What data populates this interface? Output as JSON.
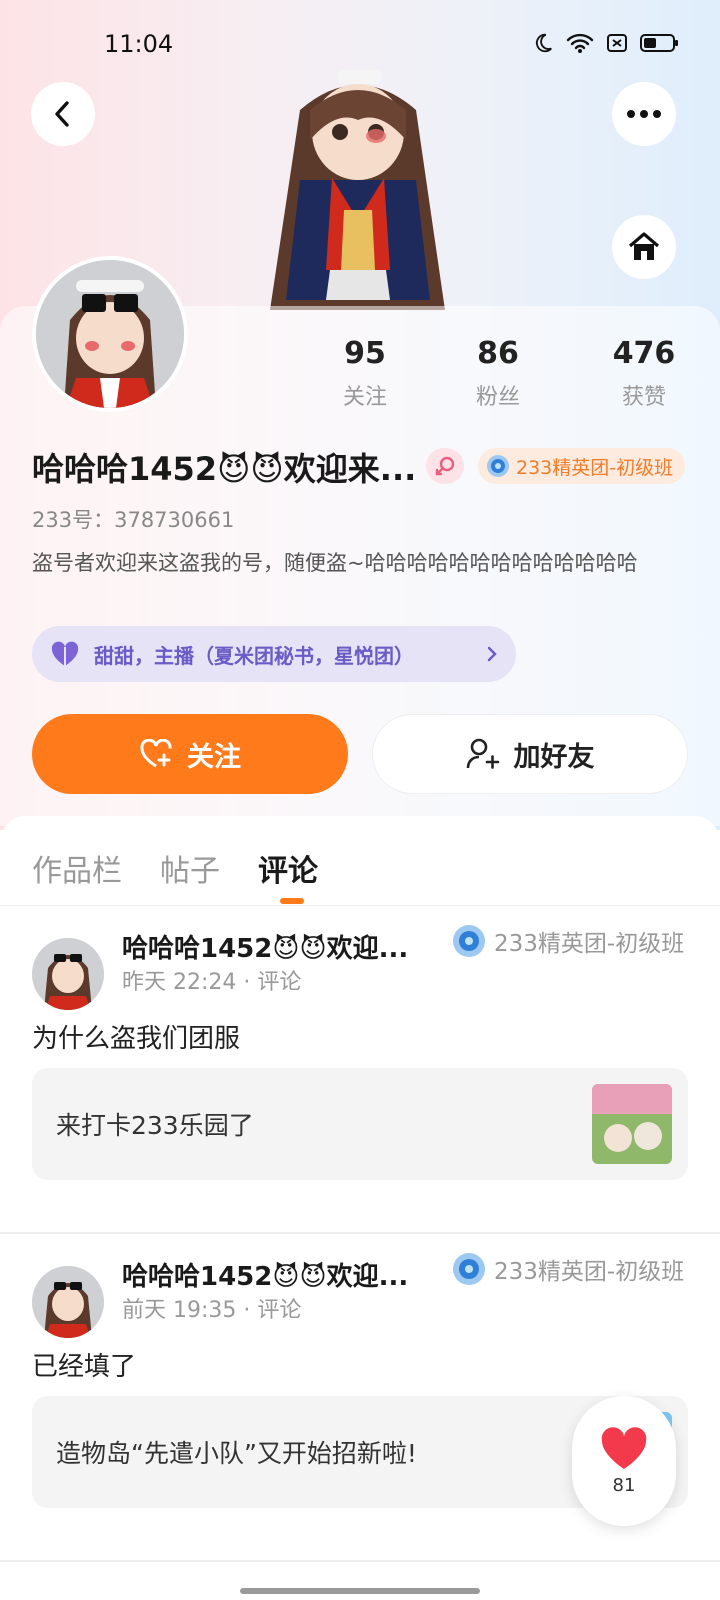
{
  "status_bar": {
    "time": "11:04"
  },
  "profile": {
    "stats": [
      {
        "value": "95",
        "label": "关注"
      },
      {
        "value": "86",
        "label": "粉丝"
      },
      {
        "value": "476",
        "label": "获赞"
      }
    ],
    "name": "哈哈哈1452😈😈欢迎来...",
    "elite_badge": "233精英团-初级班",
    "uid_label": "233号：",
    "uid_value": "378730661",
    "bio": "盗号者欢迎来这盗我的号，随便盗~哈哈哈哈哈哈哈哈哈哈哈哈哈",
    "groups": "甜甜，主播（夏米团秘书，星悦团）"
  },
  "actions": {
    "follow": "关注",
    "add_friend": "加好友"
  },
  "tabs": [
    {
      "label": "作品栏"
    },
    {
      "label": "帖子"
    },
    {
      "label": "评论"
    }
  ],
  "posts": [
    {
      "author": "哈哈哈1452😈😈欢迎...",
      "badge": "233精英团-初级班",
      "meta": "昨天 22:24 · 评论",
      "text": "为什么盗我们团服",
      "quote": "来打卡233乐园了"
    },
    {
      "author": "哈哈哈1452😈😈欢迎...",
      "badge": "233精英团-初级班",
      "meta": "前天 19:35 · 评论",
      "text": "已经填了",
      "quote": "造物岛“先遣小队”又开始招新啦!"
    }
  ],
  "like_fab": {
    "count": "81"
  },
  "colors": {
    "accent": "#ff7a1a",
    "purple": "#6a5bc7",
    "badge_orange": "#f07d2a"
  }
}
